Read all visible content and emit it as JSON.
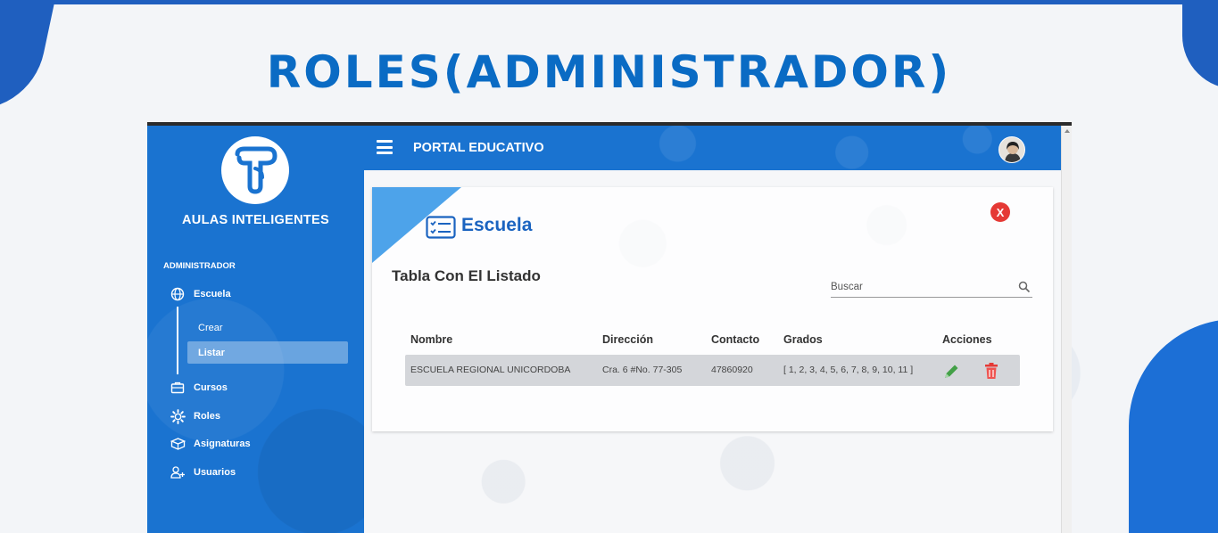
{
  "slide": {
    "title": "ROLES(ADMINISTRADOR)"
  },
  "sidebar": {
    "brand": "AULAS INTELIGENTES",
    "section_label": "ADMINISTRADOR",
    "items": [
      {
        "label": "Escuela",
        "icon": "globe-icon"
      },
      {
        "label": "Cursos",
        "icon": "briefcase-icon"
      },
      {
        "label": "Roles",
        "icon": "gear-icon"
      },
      {
        "label": "Asignaturas",
        "icon": "books-icon"
      },
      {
        "label": "Usuarios",
        "icon": "user-add-icon"
      }
    ],
    "subitems": [
      {
        "label": "Crear",
        "active": false
      },
      {
        "label": "Listar",
        "active": true
      }
    ]
  },
  "header": {
    "title": "PORTAL EDUCATIVO"
  },
  "card": {
    "title": "Escuela",
    "list_title": "Tabla Con El Listado",
    "search": {
      "placeholder": "Buscar",
      "value": ""
    },
    "close_label": "X",
    "table": {
      "headers": [
        "Nombre",
        "Dirección",
        "Contacto",
        "Grados",
        "Acciones"
      ],
      "rows": [
        {
          "nombre": "ESCUELA REGIONAL UNICORDOBA",
          "direccion": "Cra. 6 #No. 77-305",
          "contacto": "47860920",
          "grados": "[ 1, 2, 3, 4, 5, 6, 7, 8, 9, 10, 11 ]"
        }
      ]
    }
  },
  "colors": {
    "primary": "#1a73d0",
    "title": "#0a6bc4",
    "accent": "#4da3ea",
    "edit": "#43a047",
    "delete": "#e53935"
  }
}
